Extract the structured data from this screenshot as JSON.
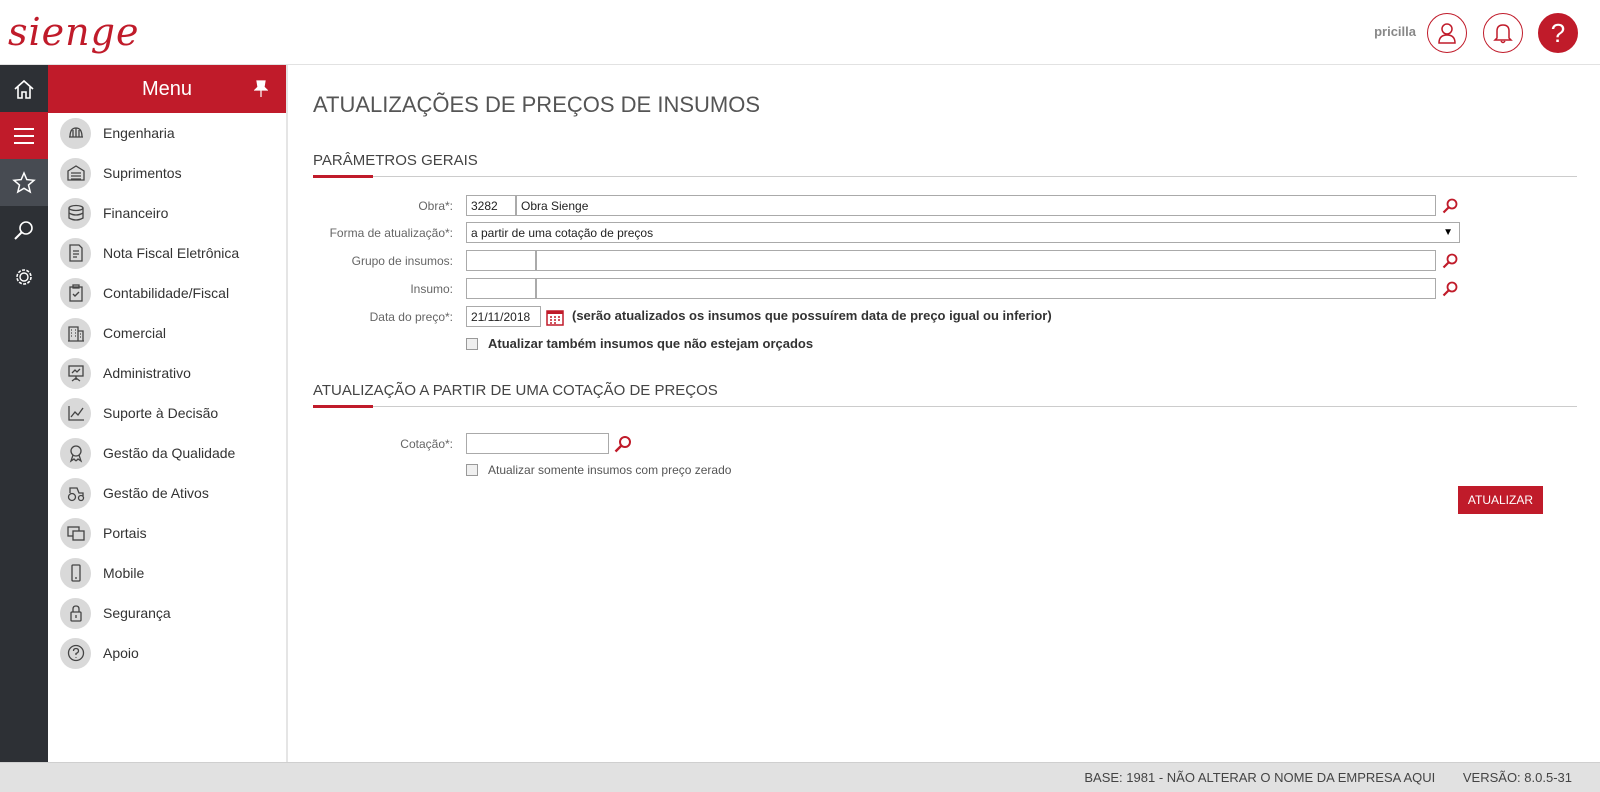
{
  "header": {
    "logo": "sienge",
    "user_name": "pricilla",
    "help_label": "?"
  },
  "rail": [
    "home-icon",
    "menu-icon",
    "star-icon",
    "search-icon",
    "gear-icon"
  ],
  "menu": {
    "title": "Menu",
    "items": [
      {
        "label": "Engenharia",
        "icon": "helmet-icon"
      },
      {
        "label": "Suprimentos",
        "icon": "warehouse-icon"
      },
      {
        "label": "Financeiro",
        "icon": "coins-icon"
      },
      {
        "label": "Nota Fiscal Eletrônica",
        "icon": "invoice-icon"
      },
      {
        "label": "Contabilidade/Fiscal",
        "icon": "clipboard-check-icon"
      },
      {
        "label": "Comercial",
        "icon": "building-icon"
      },
      {
        "label": "Administrativo",
        "icon": "presentation-icon"
      },
      {
        "label": "Suporte à Decisão",
        "icon": "chart-icon"
      },
      {
        "label": "Gestão da Qualidade",
        "icon": "award-icon"
      },
      {
        "label": "Gestão de Ativos",
        "icon": "tractor-icon"
      },
      {
        "label": "Portais",
        "icon": "windows-icon"
      },
      {
        "label": "Mobile",
        "icon": "mobile-icon"
      },
      {
        "label": "Segurança",
        "icon": "lock-icon"
      },
      {
        "label": "Apoio",
        "icon": "question-icon"
      }
    ]
  },
  "page": {
    "title": "ATUALIZAÇÕES DE PREÇOS DE INSUMOS",
    "section1_title": "PARÂMETROS GERAIS",
    "section2_title": "ATUALIZAÇÃO A PARTIR DE UMA COTAÇÃO DE PREÇOS"
  },
  "form": {
    "obra_label": "Obra*:",
    "obra_code": "3282",
    "obra_name": "Obra Sienge",
    "forma_label": "Forma de atualização*:",
    "forma_value": "a partir de uma cotação de preços",
    "grupo_label": "Grupo de insumos:",
    "grupo_code": "",
    "grupo_name": "",
    "insumo_label": "Insumo:",
    "insumo_code": "",
    "insumo_name": "",
    "data_label": "Data do preço*:",
    "data_value": "21/11/2018",
    "data_note": "(serão atualizados os insumos que possuírem data de preço igual ou inferior)",
    "check_orcados": "Atualizar também insumos que não estejam orçados",
    "cotacao_label": "Cotação*:",
    "cotacao_value": "",
    "check_zerado": "Atualizar somente insumos com preço zerado",
    "submit_label": "ATUALIZAR"
  },
  "footer": {
    "base": "BASE: 1981 - NÃO ALTERAR O NOME DA EMPRESA AQUI",
    "version": "VERSÃO: 8.0.5-31"
  },
  "colors": {
    "brand": "#c01b2a",
    "rail": "#2d3035"
  }
}
